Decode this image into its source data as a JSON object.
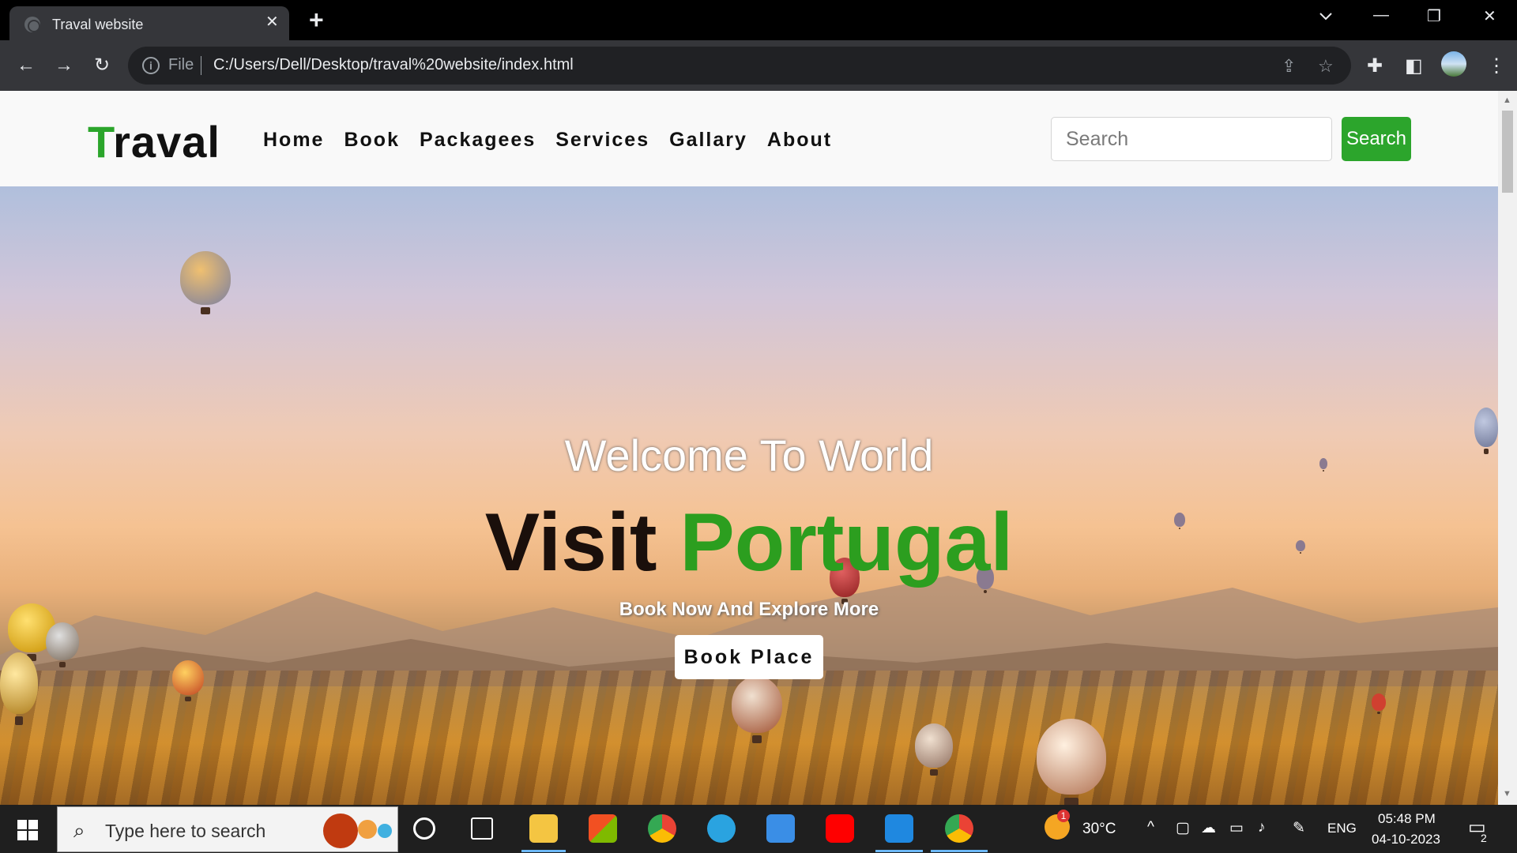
{
  "browser": {
    "tab_title": "Traval website",
    "tab_close": "✕",
    "new_tab": "+",
    "file_label": "File",
    "url": "C:/Users/Dell/Desktop/traval%20website/index.html",
    "window_controls": [
      "—",
      "❐",
      "✕"
    ]
  },
  "site": {
    "logo_first": "T",
    "logo_rest": "raval",
    "menu": [
      "Home",
      "Book",
      "Packagees",
      "Services",
      "Gallary",
      "About"
    ],
    "search_placeholder": "Search",
    "search_button": "Search",
    "hero": {
      "welcome": "Welcome To World",
      "title_main": "Visit",
      "title_accent": "Portugal",
      "subtitle": "Book Now And Explore More",
      "button": "Book Place"
    },
    "colors": {
      "accent": "#2ca52c",
      "title_dark": "#1a0f0b"
    }
  },
  "taskbar": {
    "search_placeholder": "Type here to search",
    "weather": "30°C",
    "weather_badge": "1",
    "language": "ENG",
    "time": "05:48 PM",
    "date": "04-10-2023",
    "notifications": "2"
  }
}
